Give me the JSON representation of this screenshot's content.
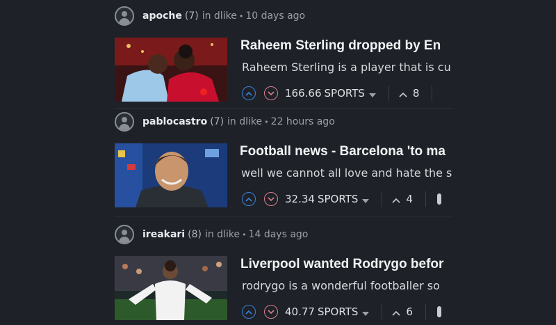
{
  "posts": [
    {
      "author": "apoche",
      "reputation": "(7)",
      "in_label": "in dlike",
      "separator": "•",
      "time": "10 days ago",
      "title": "Raheem Sterling dropped by En",
      "excerpt": "Raheem Sterling is a player that is cu",
      "amount": "166.66",
      "tag": "SPORTS",
      "replies": "8",
      "thumb_colors": {
        "bg": "#6b1e1e",
        "accent": "#c8102e",
        "accent2": "#9ec8e8"
      }
    },
    {
      "author": "pablocastro",
      "reputation": "(7)",
      "in_label": "in dlike",
      "separator": "•",
      "time": "22 hours ago",
      "title": "Football news - Barcelona 'to ma",
      "excerpt": "well we cannot all love and hate the s",
      "amount": "32.34",
      "tag": "SPORTS",
      "replies": "4",
      "thumb_colors": {
        "bg": "#1b3b7a",
        "accent": "#2a2f36",
        "accent2": "#c9956d"
      }
    },
    {
      "author": "ireakari",
      "reputation": "(8)",
      "in_label": "in dlike",
      "separator": "•",
      "time": "14 days ago",
      "title": "Liverpool wanted Rodrygo befor",
      "excerpt": "rodrygo is a wonderful footballer so",
      "amount": "40.77",
      "tag": "SPORTS",
      "replies": "6",
      "thumb_colors": {
        "bg": "#2d5a2a",
        "accent": "#f2f2f2",
        "accent2": "#6b4a36"
      }
    }
  ],
  "icons": {
    "avatar": "user-avatar-icon",
    "upvote": "chevron-up-circle-icon",
    "downvote": "chevron-down-circle-icon",
    "dropdown": "caret-down-icon",
    "reply": "chevron-up-icon"
  }
}
